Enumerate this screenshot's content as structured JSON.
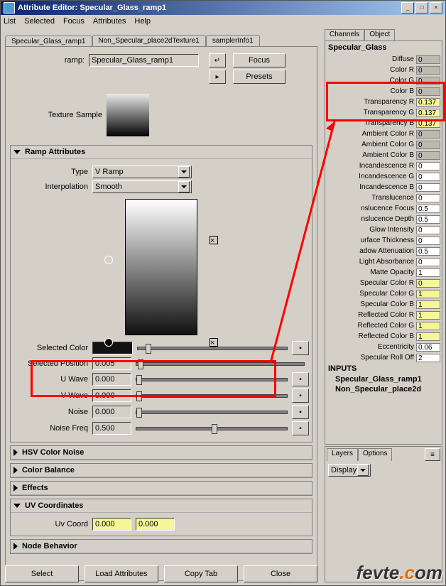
{
  "window": {
    "title": "Attribute Editor: Specular_Glass_ramp1"
  },
  "menus": [
    "List",
    "Selected",
    "Focus",
    "Attributes",
    "Help"
  ],
  "winbtns": {
    "min": "_",
    "max": "□",
    "close": "×"
  },
  "tabs": [
    "Specular_Glass_ramp1",
    "Non_Specular_place2dTexture1",
    "samplerInfo1"
  ],
  "top": {
    "rampLabel": "ramp:",
    "rampValue": "Specular_Glass_ramp1",
    "focus": "Focus",
    "presets": "Presets"
  },
  "texSampleLabel": "Texture Sample",
  "rampAttrTitle": "Ramp Attributes",
  "type": {
    "label": "Type",
    "value": "V Ramp"
  },
  "interp": {
    "label": "Interpolation",
    "value": "Smooth"
  },
  "selectedColorLabel": "Selected Color",
  "selectedPos": {
    "label": "Selected Position",
    "value": "0.005"
  },
  "uwave": {
    "label": "U Wave",
    "value": "0.000"
  },
  "vwave": {
    "label": "V Wave",
    "value": "0.000"
  },
  "noise": {
    "label": "Noise",
    "value": "0.000"
  },
  "noiseFreq": {
    "label": "Noise Freq",
    "value": "0.500"
  },
  "sections": {
    "hsv": "HSV Color Noise",
    "cbal": "Color Balance",
    "eff": "Effects",
    "uvc": "UV Coordinates",
    "nodeb": "Node Behavior"
  },
  "uvcoord": {
    "label": "Uv Coord",
    "v1": "0.000",
    "v2": "0.000"
  },
  "bottom": {
    "select": "Select",
    "load": "Load Attributes",
    "copy": "Copy Tab",
    "close": "Close"
  },
  "channels": {
    "tabs": [
      "Channels",
      "Object"
    ],
    "node": "Specular_Glass",
    "rows": [
      {
        "l": "Diffuse",
        "v": "0",
        "c": "dim"
      },
      {
        "l": "Color R",
        "v": "0",
        "c": "dim"
      },
      {
        "l": "Color G",
        "v": "0",
        "c": "dim"
      },
      {
        "l": "Color B",
        "v": "0",
        "c": "dim"
      },
      {
        "l": "Transparency R",
        "v": "0.137",
        "c": "hl"
      },
      {
        "l": "Transparency G",
        "v": "0.137",
        "c": "hl"
      },
      {
        "l": "Transparency B",
        "v": "0.137",
        "c": "hl"
      },
      {
        "l": "Ambient Color R",
        "v": "0",
        "c": "dim"
      },
      {
        "l": "Ambient Color G",
        "v": "0",
        "c": "dim"
      },
      {
        "l": "Ambient Color B",
        "v": "0",
        "c": "dim"
      },
      {
        "l": "Incandescence R",
        "v": "0",
        "c": ""
      },
      {
        "l": "Incandescence G",
        "v": "0",
        "c": ""
      },
      {
        "l": "Incandescence B",
        "v": "0",
        "c": ""
      },
      {
        "l": "Translucence",
        "v": "0",
        "c": ""
      },
      {
        "l": "nslucence Focus",
        "v": "0.5",
        "c": ""
      },
      {
        "l": "nslucence Depth",
        "v": "0.5",
        "c": ""
      },
      {
        "l": "Glow Intensity",
        "v": "0",
        "c": ""
      },
      {
        "l": "urface Thickness",
        "v": "0",
        "c": ""
      },
      {
        "l": "adow Attenuation",
        "v": "0.5",
        "c": ""
      },
      {
        "l": "Light Absorbance",
        "v": "0",
        "c": ""
      },
      {
        "l": "Matte Opacity",
        "v": "1",
        "c": ""
      },
      {
        "l": "Specular Color R",
        "v": "0",
        "c": "hl"
      },
      {
        "l": "Specular Color G",
        "v": "1",
        "c": "hl"
      },
      {
        "l": "Specular Color B",
        "v": "1",
        "c": "hl"
      },
      {
        "l": "Reflected Color R",
        "v": "1",
        "c": "hl"
      },
      {
        "l": "Reflected Color G",
        "v": "1",
        "c": "hl"
      },
      {
        "l": "Reflected Color B",
        "v": "1",
        "c": "hl"
      },
      {
        "l": "Eccentricity",
        "v": "0.06",
        "c": ""
      },
      {
        "l": "Specular Roll Off",
        "v": "2",
        "c": ""
      }
    ],
    "inputs": "INPUTS",
    "subs": [
      "Specular_Glass_ramp1",
      "Non_Specular_place2d"
    ]
  },
  "layers": {
    "tabs": [
      "Layers",
      "Options"
    ],
    "display": "Display"
  },
  "watermark": [
    "fevte",
    ".c",
    "om"
  ]
}
